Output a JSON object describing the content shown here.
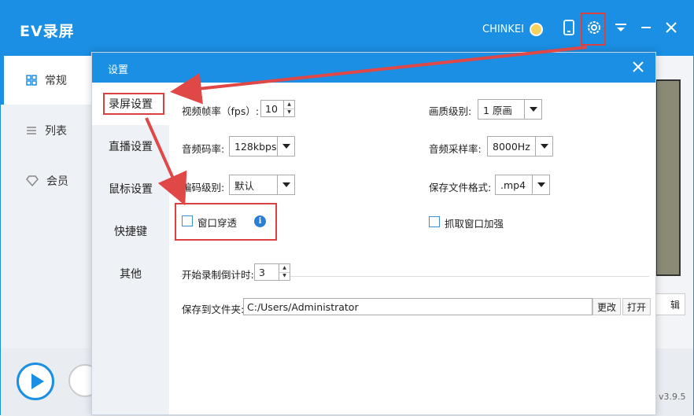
{
  "app": {
    "title": "EV录屏",
    "user": "CHINKEI",
    "version": "v3.9.5"
  },
  "sidebar": {
    "items": [
      {
        "label": "常规",
        "icon": "grid-icon",
        "active": true
      },
      {
        "label": "列表",
        "icon": "list-icon",
        "active": false
      },
      {
        "label": "会员",
        "icon": "diamond-icon",
        "active": false
      }
    ]
  },
  "preview": {
    "button_label": "辑"
  },
  "dialog": {
    "title": "设置",
    "nav": [
      {
        "label": "录屏设置",
        "active": true
      },
      {
        "label": "直播设置",
        "active": false
      },
      {
        "label": "鼠标设置",
        "active": false
      },
      {
        "label": "快捷键",
        "active": false
      },
      {
        "label": "其他",
        "active": false
      }
    ],
    "fields": {
      "fps_label": "视频帧率（fps）:",
      "fps_value": "10",
      "quality_label": "画质级别:",
      "quality_value": "1 原画",
      "audio_bitrate_label": "音频码率:",
      "audio_bitrate_value": "128kbps",
      "sample_rate_label": "音频采样率:",
      "sample_rate_value": "8000Hz",
      "encode_label": "编码级别:",
      "encode_value": "默认",
      "format_label": "保存文件格式:",
      "format_value": ".mp4",
      "window_through_label": "窗口穿透",
      "capture_enhance_label": "抓取窗口加强",
      "countdown_label": "开始录制倒计时:",
      "countdown_value": "3",
      "save_folder_label": "保存到文件夹:",
      "save_folder_value": "C:/Users/Administrator",
      "change_label": "更改",
      "open_label": "打开"
    }
  },
  "colors": {
    "accent": "#1a8fe3",
    "highlight": "#d94040"
  }
}
